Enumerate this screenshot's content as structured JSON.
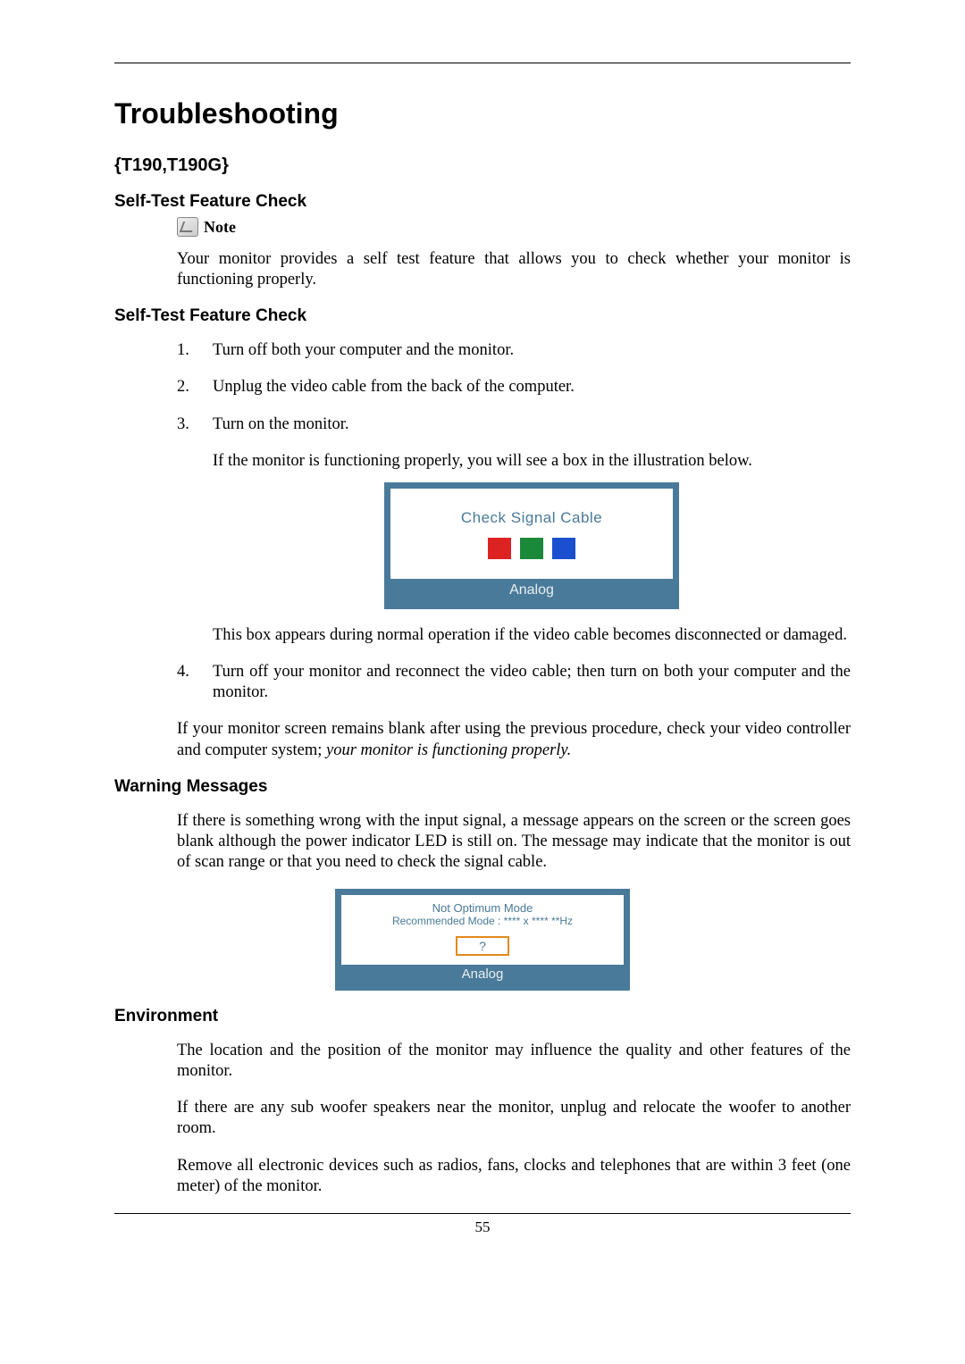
{
  "page": {
    "title": "Troubleshooting",
    "model": "{T190,T190G}",
    "page_number": "55"
  },
  "sections": {
    "selftest1": {
      "heading": "Self-Test Feature Check",
      "note_label": "Note",
      "body": "Your monitor provides a self test feature that allows you to check whether your monitor is functioning properly."
    },
    "selftest2": {
      "heading": "Self-Test Feature Check",
      "steps": {
        "s1": "Turn off both your computer and the monitor.",
        "s2": "Unplug the video cable from the back of the computer.",
        "s3": "Turn on the monitor.",
        "s3_sub": "If the monitor is functioning properly, you will see a box in the illustration below.",
        "s3_after": "This box appears during normal operation if the video cable becomes disconnected or damaged.",
        "s4": "Turn off your monitor and reconnect the video cable; then turn on both your computer and the monitor."
      },
      "closing_a": "If your monitor screen remains blank after using the previous procedure, check your video controller and computer system; ",
      "closing_b_italic": "your monitor is functioning properly."
    },
    "signal_box": {
      "title": "Check Signal Cable",
      "footer": "Analog"
    },
    "warning": {
      "heading": "Warning Messages",
      "body": "If there is something wrong with the input signal, a message appears on the screen or the screen goes blank although the power indicator LED is still on. The message may indicate that the monitor is out of scan range or that you need to check the signal cable."
    },
    "optimum_box": {
      "line1": "Not Optimum Mode",
      "line2": "Recommended Mode : **** x ****  **Hz",
      "button": "?",
      "footer": "Analog"
    },
    "environment": {
      "heading": "Environment",
      "p1": "The location and the position of the monitor may influence the quality and other features of the monitor.",
      "p2": "If there are any sub woofer speakers near the monitor, unplug and relocate the woofer to another room.",
      "p3": "Remove all electronic devices such as radios, fans, clocks and telephones that are within 3 feet (one meter) of the monitor."
    }
  }
}
